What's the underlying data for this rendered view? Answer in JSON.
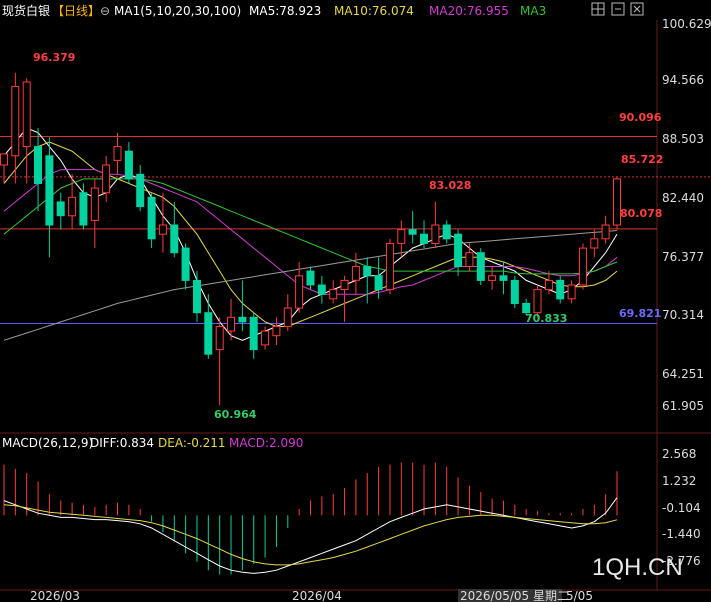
{
  "header": {
    "symbol": "现货白银",
    "period": "【日线】",
    "ma_params": "MA1(5,10,20,30,100)",
    "ma5": "MA5:78.923",
    "ma10": "MA10:76.074",
    "ma20": "MA20:76.955",
    "ma3": "MA3"
  },
  "macd_header": {
    "params": "MACD(26,12,9)",
    "diff": "DIFF:0.834",
    "dea": "DEA:-0.211",
    "macd": "MACD:2.090"
  },
  "price_axis": [
    "100.629",
    "94.566",
    "88.503",
    "82.440",
    "76.377",
    "70.314",
    "64.251",
    "61.905"
  ],
  "macd_axis": [
    "2.568",
    "1.232",
    "-0.104",
    "-1.440",
    "-2.776"
  ],
  "date_axis": [
    "2026/03",
    "2026/04",
    "2026/05/05 星期二",
    "5/05"
  ],
  "annotations": {
    "high": "96.379",
    "low": "60.964",
    "peak2": "83.028",
    "trough2": "70.833",
    "last_high": "85.722"
  },
  "hlines": {
    "upper": "90.096",
    "middle": "80.078",
    "lower": "69.821"
  },
  "watermark": "1QH.CN",
  "colors": {
    "up": "#ff3b3b",
    "down": "#00d2a0",
    "ma5": "#ffffff",
    "ma10": "#e6d84a",
    "ma20": "#d23cd2",
    "ma30": "#33c433",
    "ma100": "#9a9a9a",
    "hline_red": "#e03030",
    "hline_blue": "#5a5aff"
  },
  "chart_data": {
    "type": "candlestick",
    "price_range": [
      58.5,
      102.5
    ],
    "macd_range": [
      -3.3,
      3.0
    ],
    "candles": [
      {
        "o": 87.0,
        "h": 88.0,
        "l": 85.0,
        "c": 88.2
      },
      {
        "o": 88.0,
        "h": 97.0,
        "l": 85.0,
        "c": 95.5
      },
      {
        "o": 89.0,
        "h": 96.4,
        "l": 85.0,
        "c": 96.0
      },
      {
        "o": 89.0,
        "h": 91.0,
        "l": 82.0,
        "c": 85.0
      },
      {
        "o": 88.0,
        "h": 90.0,
        "l": 77.0,
        "c": 80.5
      },
      {
        "o": 83.0,
        "h": 84.0,
        "l": 80.0,
        "c": 81.5
      },
      {
        "o": 81.5,
        "h": 86.0,
        "l": 80.0,
        "c": 83.5
      },
      {
        "o": 84.0,
        "h": 85.0,
        "l": 80.0,
        "c": 80.5
      },
      {
        "o": 81.0,
        "h": 85.5,
        "l": 78.0,
        "c": 84.5
      },
      {
        "o": 84.0,
        "h": 88.0,
        "l": 83.0,
        "c": 87.0
      },
      {
        "o": 87.5,
        "h": 90.5,
        "l": 86.0,
        "c": 89.0
      },
      {
        "o": 88.5,
        "h": 89.5,
        "l": 85.0,
        "c": 85.5
      },
      {
        "o": 86.0,
        "h": 87.0,
        "l": 82.0,
        "c": 82.5
      },
      {
        "o": 83.5,
        "h": 84.0,
        "l": 78.0,
        "c": 79.0
      },
      {
        "o": 79.5,
        "h": 84.0,
        "l": 77.5,
        "c": 80.5
      },
      {
        "o": 80.5,
        "h": 83.0,
        "l": 77.0,
        "c": 77.5
      },
      {
        "o": 78.0,
        "h": 78.5,
        "l": 73.5,
        "c": 74.5
      },
      {
        "o": 74.5,
        "h": 75.5,
        "l": 70.0,
        "c": 71.0
      },
      {
        "o": 71.0,
        "h": 73.0,
        "l": 66.0,
        "c": 66.5
      },
      {
        "o": 67.0,
        "h": 70.5,
        "l": 60.96,
        "c": 69.5
      },
      {
        "o": 69.0,
        "h": 72.5,
        "l": 68.0,
        "c": 70.5
      },
      {
        "o": 70.5,
        "h": 74.5,
        "l": 69.0,
        "c": 70.0
      },
      {
        "o": 70.5,
        "h": 71.0,
        "l": 66.0,
        "c": 67.0
      },
      {
        "o": 67.5,
        "h": 69.5,
        "l": 67.0,
        "c": 69.0
      },
      {
        "o": 68.5,
        "h": 70.5,
        "l": 67.5,
        "c": 69.5
      },
      {
        "o": 69.5,
        "h": 73.0,
        "l": 69.0,
        "c": 71.5
      },
      {
        "o": 71.5,
        "h": 76.5,
        "l": 71.0,
        "c": 75.0
      },
      {
        "o": 75.5,
        "h": 76.0,
        "l": 73.5,
        "c": 74.0
      },
      {
        "o": 74.0,
        "h": 75.0,
        "l": 72.0,
        "c": 73.0
      },
      {
        "o": 72.5,
        "h": 74.5,
        "l": 72.0,
        "c": 73.5
      },
      {
        "o": 73.5,
        "h": 75.0,
        "l": 70.0,
        "c": 74.5
      },
      {
        "o": 74.5,
        "h": 77.5,
        "l": 73.0,
        "c": 76.0
      },
      {
        "o": 76.0,
        "h": 77.0,
        "l": 72.0,
        "c": 75.0
      },
      {
        "o": 75.0,
        "h": 77.0,
        "l": 72.5,
        "c": 73.5
      },
      {
        "o": 73.5,
        "h": 79.0,
        "l": 73.0,
        "c": 78.5
      },
      {
        "o": 78.5,
        "h": 81.0,
        "l": 77.0,
        "c": 80.0
      },
      {
        "o": 80.0,
        "h": 82.0,
        "l": 78.5,
        "c": 79.5
      },
      {
        "o": 79.5,
        "h": 81.0,
        "l": 78.0,
        "c": 78.5
      },
      {
        "o": 78.5,
        "h": 83.03,
        "l": 78.0,
        "c": 80.5
      },
      {
        "o": 80.5,
        "h": 81.0,
        "l": 78.5,
        "c": 79.0
      },
      {
        "o": 79.5,
        "h": 80.0,
        "l": 75.0,
        "c": 76.0
      },
      {
        "o": 76.0,
        "h": 78.5,
        "l": 75.5,
        "c": 77.5
      },
      {
        "o": 77.5,
        "h": 78.0,
        "l": 74.0,
        "c": 74.5
      },
      {
        "o": 74.5,
        "h": 76.0,
        "l": 73.5,
        "c": 75.0
      },
      {
        "o": 75.0,
        "h": 76.5,
        "l": 73.0,
        "c": 74.5
      },
      {
        "o": 74.5,
        "h": 75.0,
        "l": 71.5,
        "c": 72.0
      },
      {
        "o": 72.0,
        "h": 72.5,
        "l": 70.83,
        "c": 71.0
      },
      {
        "o": 71.0,
        "h": 74.0,
        "l": 70.5,
        "c": 73.5
      },
      {
        "o": 73.5,
        "h": 75.5,
        "l": 73.0,
        "c": 74.5
      },
      {
        "o": 74.5,
        "h": 75.0,
        "l": 72.0,
        "c": 72.5
      },
      {
        "o": 72.5,
        "h": 74.5,
        "l": 72.0,
        "c": 74.0
      },
      {
        "o": 74.0,
        "h": 78.5,
        "l": 73.5,
        "c": 78.0
      },
      {
        "o": 78.0,
        "h": 80.0,
        "l": 77.0,
        "c": 79.0
      },
      {
        "o": 79.0,
        "h": 81.5,
        "l": 78.5,
        "c": 80.5
      },
      {
        "o": 80.5,
        "h": 85.72,
        "l": 80.0,
        "c": 85.5
      }
    ],
    "ma_lines": [
      {
        "name": "MA5",
        "values": [
          88.0,
          89.5,
          91.0,
          90.5,
          89.0,
          87.5,
          85.5,
          84.0,
          83.5,
          84.0,
          85.5,
          86.0,
          85.5,
          83.5,
          81.5,
          80.0,
          77.5,
          74.5,
          72.0,
          70.0,
          68.5,
          68.0,
          68.5,
          69.0,
          69.5,
          70.0,
          71.5,
          72.5,
          73.0,
          73.5,
          74.0,
          74.5,
          75.0,
          75.0,
          76.0,
          77.0,
          78.0,
          78.5,
          79.0,
          79.5,
          79.0,
          78.0,
          77.0,
          76.5,
          76.0,
          75.5,
          74.5,
          74.0,
          73.5,
          73.0,
          73.5,
          74.5,
          76.0,
          77.5,
          79.5
        ]
      },
      {
        "name": "MA10",
        "values": [
          85.0,
          86.5,
          88.0,
          89.0,
          89.5,
          89.0,
          88.5,
          87.5,
          86.5,
          86.0,
          85.5,
          85.0,
          84.5,
          84.0,
          83.5,
          82.5,
          81.0,
          79.5,
          77.5,
          75.5,
          73.5,
          72.0,
          71.0,
          70.0,
          69.5,
          69.5,
          70.0,
          70.5,
          71.0,
          71.5,
          72.0,
          72.5,
          73.0,
          73.5,
          74.0,
          74.5,
          75.0,
          75.5,
          76.0,
          76.5,
          77.0,
          77.0,
          77.0,
          76.8,
          76.5,
          76.0,
          75.5,
          75.0,
          74.5,
          74.0,
          73.8,
          73.8,
          74.0,
          74.5,
          75.5
        ]
      },
      {
        "name": "MA20",
        "values": [
          82.0,
          83.0,
          84.0,
          85.0,
          86.0,
          86.5,
          86.5,
          86.5,
          86.5,
          86.0,
          86.0,
          85.8,
          85.5,
          85.0,
          84.5,
          84.0,
          83.5,
          83.0,
          82.0,
          81.0,
          80.0,
          79.0,
          78.0,
          77.0,
          76.0,
          75.0,
          74.0,
          73.5,
          73.0,
          73.0,
          73.0,
          73.0,
          73.0,
          73.2,
          73.5,
          73.8,
          74.0,
          74.5,
          75.0,
          75.5,
          76.0,
          76.0,
          76.0,
          76.0,
          76.0,
          76.0,
          75.8,
          75.5,
          75.2,
          75.0,
          75.0,
          75.2,
          75.5,
          76.0,
          77.0
        ]
      },
      {
        "name": "MA30",
        "values": [
          79.5,
          80.5,
          81.5,
          82.5,
          83.5,
          84.5,
          85.0,
          85.5,
          85.5,
          85.5,
          85.5,
          85.5,
          85.5,
          85.3,
          85.0,
          84.5,
          84.0,
          83.5,
          83.0,
          82.5,
          82.0,
          81.5,
          81.0,
          80.5,
          80.0,
          79.5,
          79.0,
          78.5,
          78.0,
          77.5,
          77.0,
          76.5,
          76.0,
          75.8,
          75.5,
          75.5,
          75.5,
          75.5,
          75.5,
          75.5,
          75.5,
          75.5,
          75.5,
          75.5,
          75.5,
          75.3,
          75.2,
          75.2,
          75.2,
          75.2,
          75.2,
          75.3,
          75.5,
          76.0,
          76.5
        ]
      },
      {
        "name": "MA100",
        "values": [
          68.0,
          68.4,
          68.8,
          69.2,
          69.6,
          70.0,
          70.4,
          70.8,
          71.2,
          71.6,
          72.0,
          72.3,
          72.6,
          72.9,
          73.2,
          73.5,
          73.7,
          73.9,
          74.1,
          74.3,
          74.5,
          74.7,
          74.9,
          75.1,
          75.3,
          75.5,
          75.7,
          75.9,
          76.1,
          76.3,
          76.5,
          76.7,
          76.9,
          77.1,
          77.3,
          77.5,
          77.7,
          77.9,
          78.1,
          78.3,
          78.5,
          78.6,
          78.7,
          78.8,
          78.9,
          79.0,
          79.1,
          79.2,
          79.3,
          79.4,
          79.5,
          79.6,
          79.7,
          79.8,
          79.9
        ]
      }
    ],
    "macd": {
      "bars": [
        2.4,
        2.2,
        2.0,
        1.6,
        1.0,
        0.7,
        0.6,
        0.5,
        0.4,
        0.5,
        0.6,
        0.5,
        0.3,
        -0.3,
        -0.8,
        -1.2,
        -1.8,
        -2.2,
        -2.6,
        -2.8,
        -2.8,
        -2.6,
        -2.3,
        -2.0,
        -1.5,
        -0.6,
        0.3,
        0.7,
        0.9,
        1.0,
        1.3,
        1.7,
        2.0,
        2.3,
        2.4,
        2.5,
        2.5,
        2.4,
        2.5,
        2.3,
        1.8,
        1.4,
        1.1,
        0.8,
        0.7,
        0.5,
        0.3,
        0.2,
        0.1,
        0.1,
        0.1,
        0.3,
        0.5,
        1.0,
        2.09
      ],
      "diff": [
        0.7,
        0.5,
        0.3,
        0.1,
        0.0,
        -0.1,
        -0.1,
        -0.15,
        -0.2,
        -0.2,
        -0.25,
        -0.3,
        -0.4,
        -0.6,
        -0.9,
        -1.2,
        -1.5,
        -1.8,
        -2.1,
        -2.4,
        -2.6,
        -2.7,
        -2.75,
        -2.7,
        -2.6,
        -2.4,
        -2.2,
        -2.0,
        -1.8,
        -1.6,
        -1.4,
        -1.2,
        -0.9,
        -0.6,
        -0.3,
        -0.1,
        0.1,
        0.3,
        0.4,
        0.5,
        0.4,
        0.3,
        0.2,
        0.1,
        0.0,
        -0.1,
        -0.2,
        -0.3,
        -0.4,
        -0.5,
        -0.6,
        -0.5,
        -0.3,
        0.1,
        0.834
      ],
      "dea": [
        0.5,
        0.45,
        0.35,
        0.25,
        0.15,
        0.1,
        0.05,
        0.0,
        -0.05,
        -0.1,
        -0.15,
        -0.2,
        -0.25,
        -0.35,
        -0.5,
        -0.7,
        -0.9,
        -1.1,
        -1.35,
        -1.6,
        -1.85,
        -2.05,
        -2.2,
        -2.3,
        -2.35,
        -2.35,
        -2.3,
        -2.2,
        -2.1,
        -2.0,
        -1.85,
        -1.7,
        -1.5,
        -1.3,
        -1.1,
        -0.9,
        -0.7,
        -0.5,
        -0.35,
        -0.2,
        -0.1,
        -0.05,
        0.0,
        0.0,
        -0.05,
        -0.1,
        -0.15,
        -0.2,
        -0.25,
        -0.3,
        -0.35,
        -0.4,
        -0.4,
        -0.35,
        -0.211
      ]
    }
  }
}
